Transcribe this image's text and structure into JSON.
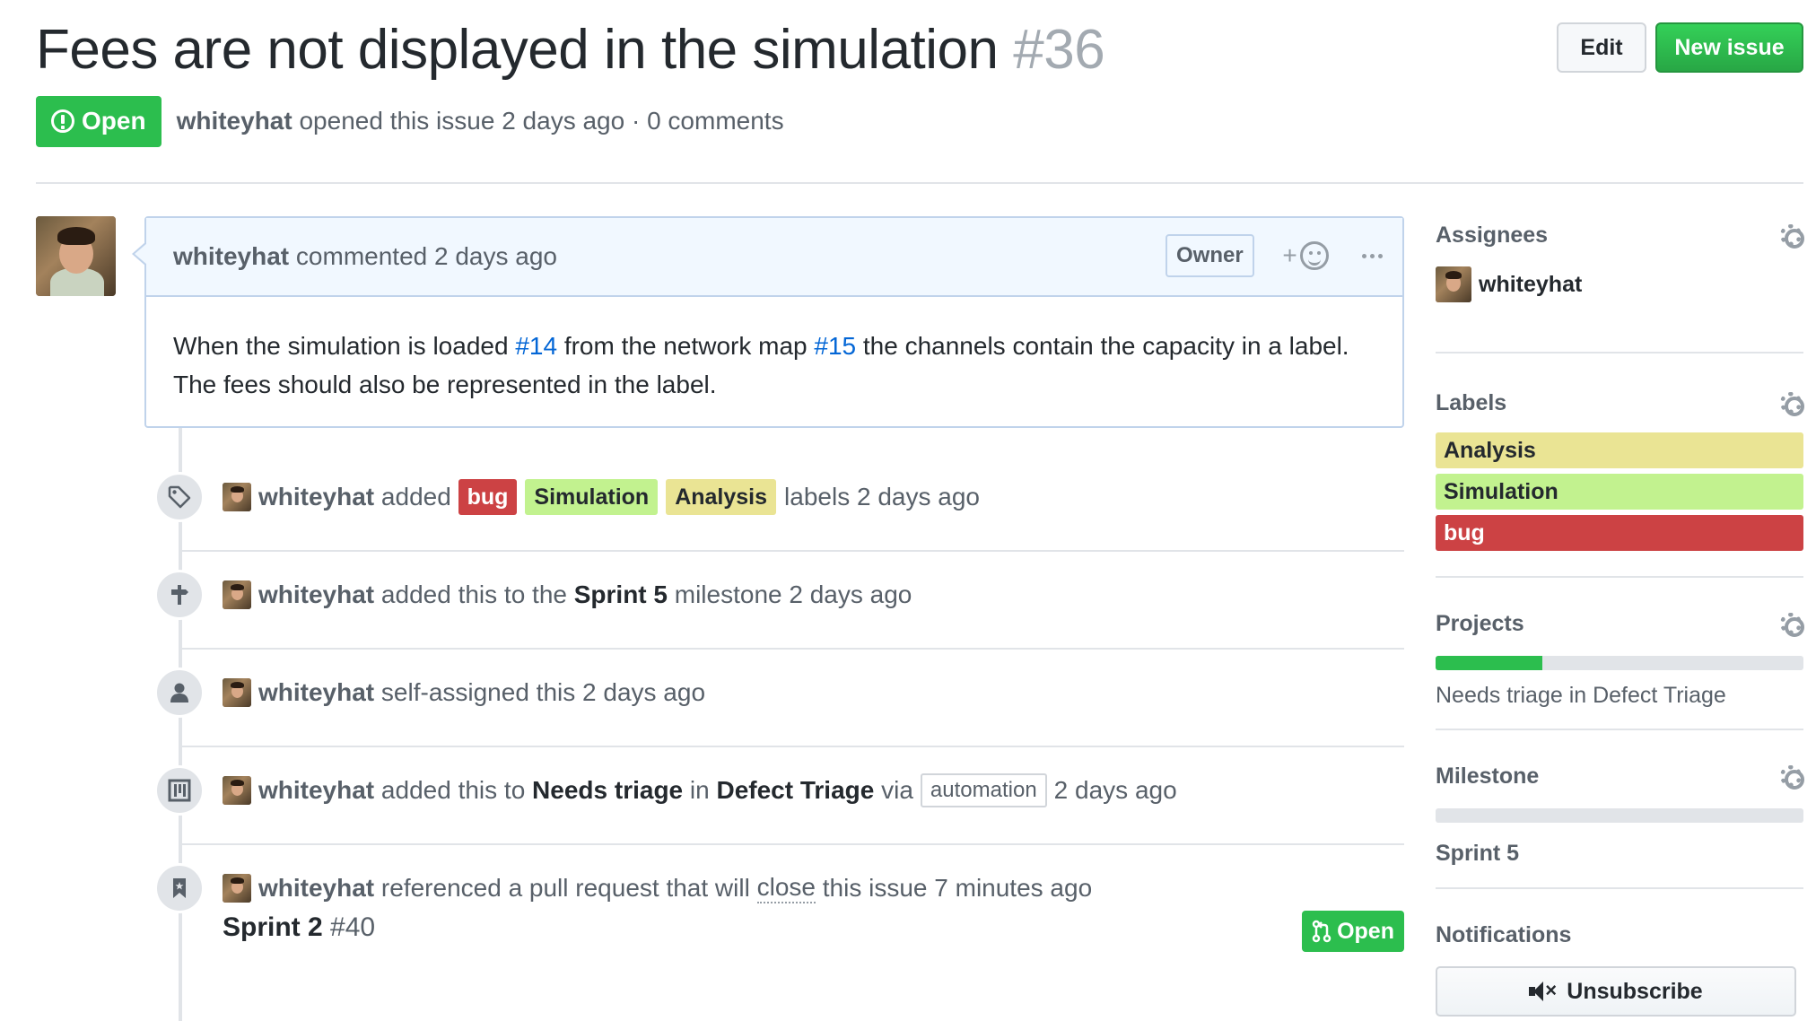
{
  "issue": {
    "title": "Fees are not displayed in the simulation",
    "number": "#36",
    "state": "Open",
    "author": "whiteyhat",
    "opened_text": "opened this issue 2 days ago · 0 comments"
  },
  "header_actions": {
    "edit_label": "Edit",
    "new_issue_label": "New issue"
  },
  "comment": {
    "author": "whiteyhat",
    "when": "commented 2 days ago",
    "role_badge": "Owner",
    "reaction_plus": "+",
    "body_part1": "When the simulation is loaded ",
    "ref1": "#14",
    "body_part2": " from the network map ",
    "ref2": "#15",
    "body_part3": " the channels contain the capacity in a label. The fees should also be represented in the label."
  },
  "timeline": {
    "labels_event": {
      "actor": "whiteyhat",
      "verb": "added",
      "labels": [
        "bug",
        "Simulation",
        "Analysis"
      ],
      "suffix": "labels 2 days ago",
      "icon": "tag-icon"
    },
    "milestone_event": {
      "actor": "whiteyhat",
      "prefix": "added this to the",
      "milestone": "Sprint 5",
      "suffix": "milestone 2 days ago",
      "icon": "milestone-icon"
    },
    "assign_event": {
      "actor": "whiteyhat",
      "text": "self-assigned this 2 days ago",
      "icon": "person-icon"
    },
    "project_event": {
      "actor": "whiteyhat",
      "prefix": "added this to",
      "column": "Needs triage",
      "in_word": "in",
      "project": "Defect Triage",
      "via": "via",
      "tag": "automation",
      "suffix": "2 days ago",
      "icon": "project-icon"
    },
    "reference_event": {
      "actor": "whiteyhat",
      "prefix": "referenced a pull request that will",
      "close_word": "close",
      "suffix": "this issue 7 minutes ago",
      "icon": "bookmark-icon",
      "pr_title": "Sprint 2",
      "pr_number": "#40",
      "pr_state": "Open"
    }
  },
  "sidebar": {
    "assignees": {
      "heading": "Assignees",
      "user": "whiteyhat"
    },
    "labels": {
      "heading": "Labels",
      "items": [
        {
          "name": "Analysis",
          "color": "#eae494"
        },
        {
          "name": "Simulation",
          "color": "#c2f28f"
        },
        {
          "name": "bug",
          "color": "#cc4244"
        }
      ]
    },
    "projects": {
      "heading": "Projects",
      "progress": 0.29,
      "status": "Needs triage in Defect Triage"
    },
    "milestone": {
      "heading": "Milestone",
      "progress": 0,
      "name": "Sprint 5"
    },
    "notifications": {
      "heading": "Notifications",
      "button_label": "Unsubscribe"
    }
  },
  "colors": {
    "open_green": "#2cbe4e",
    "link_blue": "#0366d6",
    "comment_border": "#c0d3eb"
  }
}
